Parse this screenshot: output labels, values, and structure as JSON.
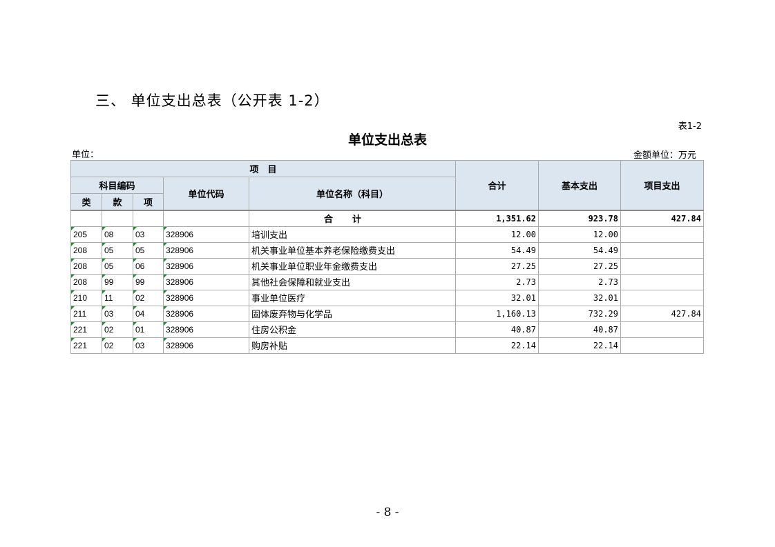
{
  "section_heading": "三、 单位支出总表（公开表 1-2）",
  "table_number": "表1-2",
  "table_title": "单位支出总表",
  "unit_label": "单位：",
  "amount_unit": "金额单位：万元",
  "headers": {
    "item": "项　目",
    "subject_code": "科目编码",
    "lei": "类",
    "kuan": "款",
    "xiang": "项",
    "unit_code": "单位代码",
    "unit_name": "单位名称（科目）",
    "total": "合计",
    "basic": "基本支出",
    "project": "项目支出"
  },
  "total_row": {
    "label": "合计",
    "total": "1,351.62",
    "basic": "923.78",
    "project": "427.84"
  },
  "rows": [
    {
      "lei": "205",
      "kuan": "08",
      "xiang": "03",
      "code": "328906",
      "name": "培训支出",
      "total": "12.00",
      "basic": "12.00",
      "project": ""
    },
    {
      "lei": "208",
      "kuan": "05",
      "xiang": "05",
      "code": "328906",
      "name": "机关事业单位基本养老保险缴费支出",
      "total": "54.49",
      "basic": "54.49",
      "project": ""
    },
    {
      "lei": "208",
      "kuan": "05",
      "xiang": "06",
      "code": "328906",
      "name": "机关事业单位职业年金缴费支出",
      "total": "27.25",
      "basic": "27.25",
      "project": ""
    },
    {
      "lei": "208",
      "kuan": "99",
      "xiang": "99",
      "code": "328906",
      "name": "其他社会保障和就业支出",
      "total": "2.73",
      "basic": "2.73",
      "project": ""
    },
    {
      "lei": "210",
      "kuan": "11",
      "xiang": "02",
      "code": "328906",
      "name": "事业单位医疗",
      "total": "32.01",
      "basic": "32.01",
      "project": ""
    },
    {
      "lei": "211",
      "kuan": "03",
      "xiang": "04",
      "code": "328906",
      "name": "固体废弃物与化学品",
      "total": "1,160.13",
      "basic": "732.29",
      "project": "427.84"
    },
    {
      "lei": "221",
      "kuan": "02",
      "xiang": "01",
      "code": "328906",
      "name": "住房公积金",
      "total": "40.87",
      "basic": "40.87",
      "project": ""
    },
    {
      "lei": "221",
      "kuan": "02",
      "xiang": "03",
      "code": "328906",
      "name": "购房补贴",
      "total": "22.14",
      "basic": "22.14",
      "project": ""
    }
  ],
  "page_number": "- 8 -"
}
